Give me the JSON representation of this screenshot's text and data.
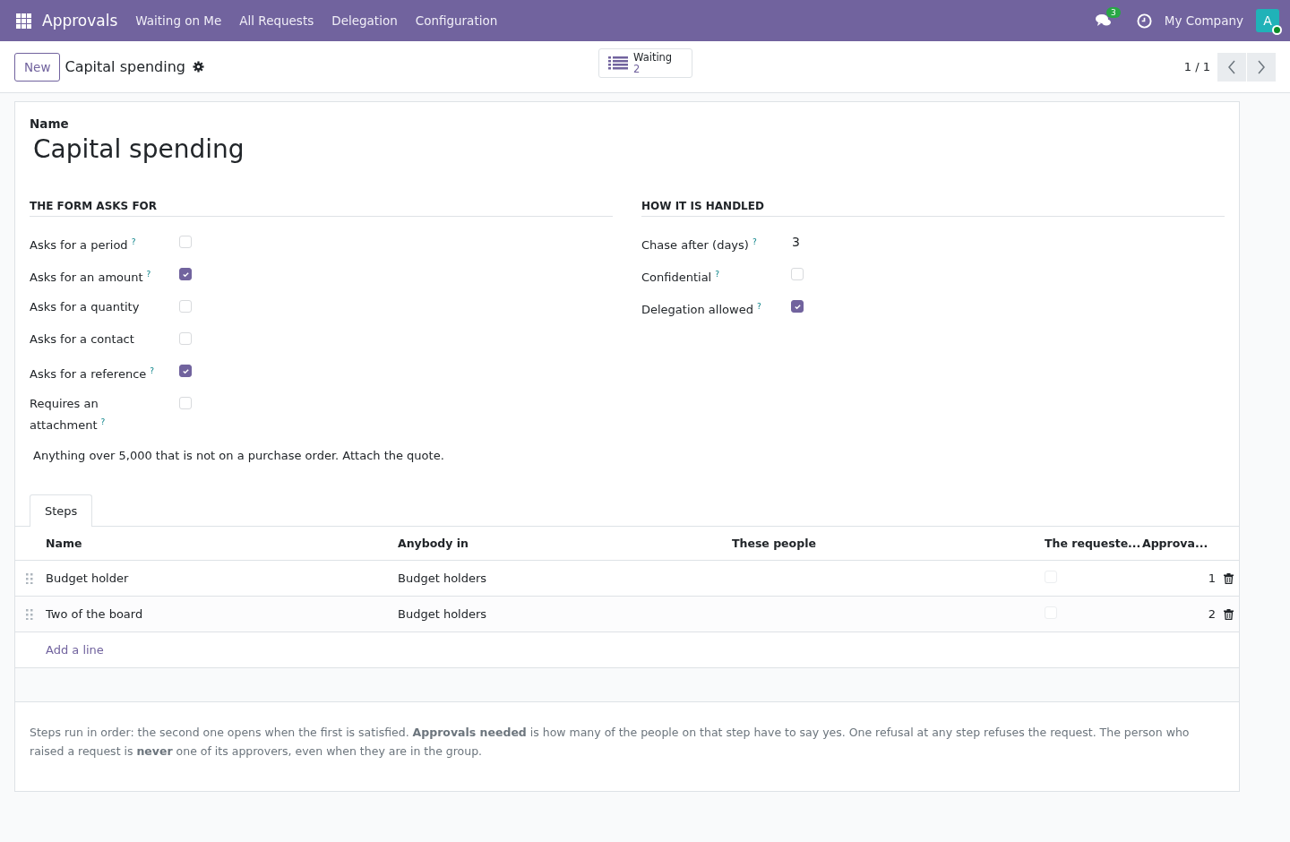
{
  "navbar": {
    "app": "Approvals",
    "menus": [
      "Waiting on Me",
      "All Requests",
      "Delegation",
      "Configuration"
    ],
    "messages_count": "3",
    "company": "My Company",
    "avatar": "A"
  },
  "control_panel": {
    "new_button": "New",
    "breadcrumb": "Capital spending",
    "smart_button": {
      "label": "Waiting",
      "value": "2"
    },
    "pager": "1 / 1"
  },
  "form": {
    "name_label": "Name",
    "name_value": "Capital spending",
    "left_section": {
      "title": "THE FORM ASKS FOR",
      "fields": [
        {
          "label": "Asks for a period",
          "help": "?",
          "checked": false
        },
        {
          "label": "Asks for an amount",
          "help": "?",
          "checked": true
        },
        {
          "label": "Asks for a quantity",
          "checked": false
        },
        {
          "label": "Asks for a contact",
          "checked": false
        },
        {
          "label": "Asks for a reference",
          "help": "?",
          "checked": true
        },
        {
          "label": "Requires an attachment",
          "help": "?",
          "checked": false
        }
      ]
    },
    "right_section": {
      "title": "HOW IT IS HANDLED",
      "fields": [
        {
          "kind": "number",
          "label": "Chase after (days)",
          "help": "?",
          "value": "3"
        },
        {
          "kind": "checkbox",
          "label": "Confidential",
          "help": "?",
          "checked": false
        },
        {
          "kind": "checkbox",
          "label": "Delegation allowed",
          "help": "?",
          "checked": true
        }
      ]
    },
    "description": "Anything over 5,000 that is not on a purchase order. Attach the quote.",
    "tabs": [
      {
        "label": "Steps",
        "selected": true
      }
    ],
    "steps": {
      "columns": [
        "Name",
        "Anybody in",
        "These people",
        "The requeste...",
        "Approva..."
      ],
      "rows": [
        {
          "name": "Budget holder",
          "group": "Budget holders",
          "requester": false,
          "approvals": "1"
        },
        {
          "name": "Two of the board",
          "group": "Budget holders",
          "requester": false,
          "approvals": "2"
        }
      ],
      "add_line": "Add a line"
    },
    "note": "Steps run in order: the second one opens when the first is satisfied. **Approvals needed** is how many of the people on that step have to say yes. One refusal at any step refuses the request. The person who raised a request is **never** one of its approvers, even when they are in the group."
  }
}
